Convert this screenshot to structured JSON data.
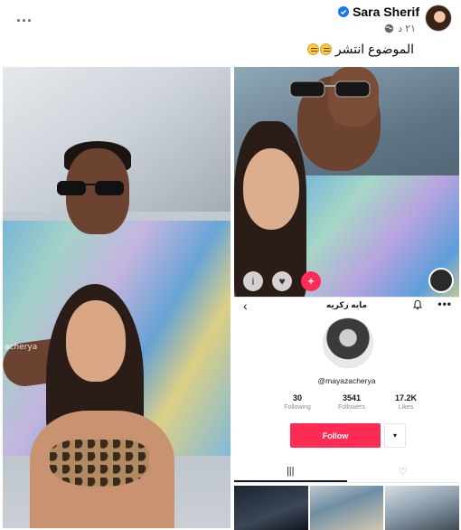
{
  "post": {
    "author": "Sara Sherif",
    "time": "٢١ د",
    "text": "الموضوع انتشر",
    "emojis": [
      "weary-face",
      "weary-face"
    ],
    "more_label": "..."
  },
  "photos": {
    "left_watermark": "acherya"
  },
  "tiktok": {
    "display_name": "مايه زكريه",
    "handle": "@mayazacherya",
    "stats": [
      {
        "value": "30",
        "label": "Following"
      },
      {
        "value": "3541",
        "label": "Followers"
      },
      {
        "value": "17.2K",
        "label": "Likes"
      }
    ],
    "follow_label": "Follow",
    "dropdown_label": "▾",
    "tab_videos_icon": "|||",
    "tab_liked_icon": "♡",
    "back_icon": "‹",
    "more_icon": "•••"
  },
  "colors": {
    "tiktok_red": "#fe2c55",
    "facebook_verified": "#1877f2",
    "text_secondary": "#65676b"
  },
  "icons": [
    "verified-badge-icon",
    "globe-icon",
    "bell-icon",
    "heart-icon",
    "grid-icon"
  ]
}
